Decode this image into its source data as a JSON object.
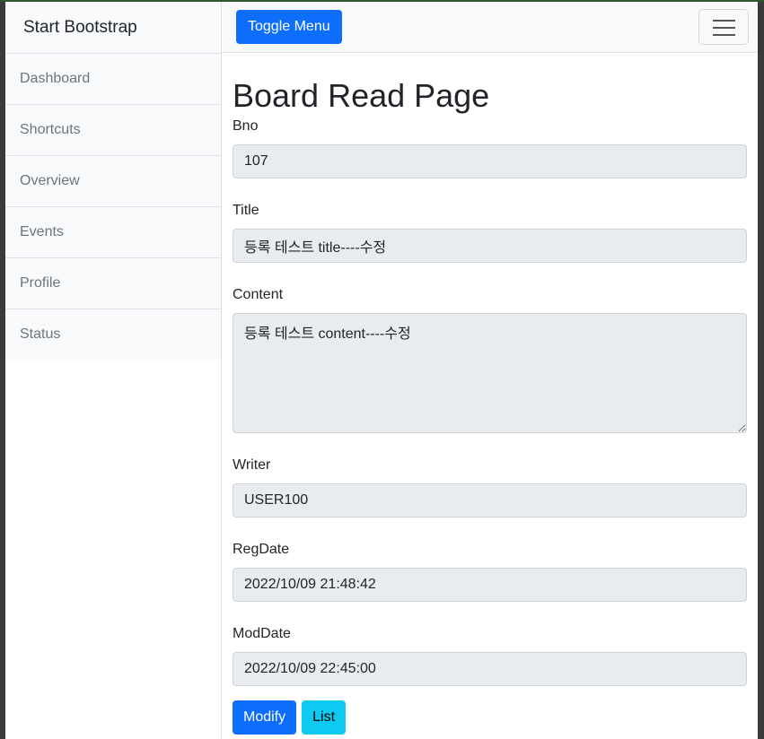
{
  "sidebar": {
    "heading": "Start Bootstrap",
    "items": [
      {
        "label": "Dashboard"
      },
      {
        "label": "Shortcuts"
      },
      {
        "label": "Overview"
      },
      {
        "label": "Events"
      },
      {
        "label": "Profile"
      },
      {
        "label": "Status"
      }
    ]
  },
  "topbar": {
    "toggle_label": "Toggle Menu",
    "hamburger_icon": "hamburger-menu-icon"
  },
  "page": {
    "title": "Board Read Page"
  },
  "form": {
    "bno": {
      "label": "Bno",
      "value": "107"
    },
    "title": {
      "label": "Title",
      "value": "등록 테스트 title----수정"
    },
    "content": {
      "label": "Content",
      "value": "등록 테스트 content----수정"
    },
    "writer": {
      "label": "Writer",
      "value": "USER100"
    },
    "regdate": {
      "label": "RegDate",
      "value": "2022/10/09 21:48:42"
    },
    "moddate": {
      "label": "ModDate",
      "value": "2022/10/09 22:45:00"
    }
  },
  "actions": {
    "modify_label": "Modify",
    "list_label": "List"
  },
  "colors": {
    "primary": "#0d6efd",
    "info": "#0dcaf0",
    "readonly_bg": "#e9ecef"
  }
}
